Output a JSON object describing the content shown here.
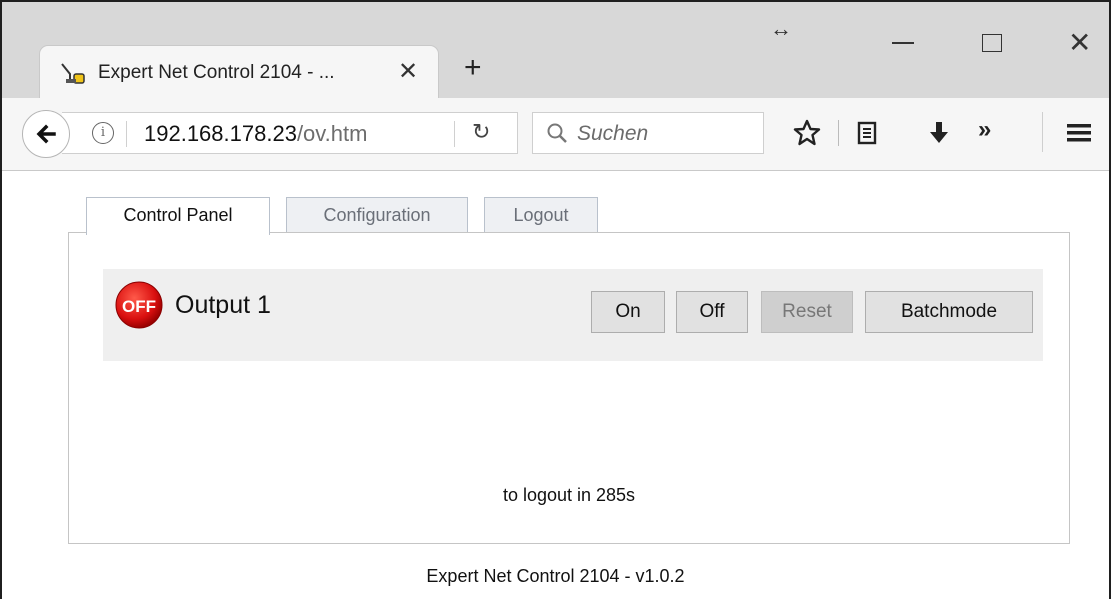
{
  "browser": {
    "tab_title": "Expert Net Control 2104 - ...",
    "new_tab_symbol": "+",
    "url_host": "192.168.178.23",
    "url_path": "/ov.htm",
    "search_placeholder": "Suchen"
  },
  "page": {
    "tabs": [
      {
        "label": "Control Panel",
        "active": true
      },
      {
        "label": "Configuration",
        "active": false
      },
      {
        "label": "Logout",
        "active": false
      }
    ],
    "output": {
      "status_badge": "OFF",
      "label": "Output 1",
      "buttons": {
        "on": "On",
        "off": "Off",
        "reset": "Reset",
        "batchmode": "Batchmode"
      }
    },
    "logout_notice": "to logout in 285s",
    "footer": "Expert Net Control 2104 - v1.0.2"
  },
  "colors": {
    "off_badge": "#d90f0f",
    "tab_strip": "#d8d8d8",
    "output_row_bg": "#efefef"
  },
  "icons": [
    "plug-favicon-icon",
    "close-tab-icon",
    "resize-icon",
    "minimize-icon",
    "maximize-icon",
    "close-window-icon",
    "back-arrow-icon",
    "info-icon",
    "reload-icon",
    "search-icon",
    "star-icon",
    "reader-icon",
    "download-icon",
    "overflow-icon",
    "hamburger-menu-icon"
  ]
}
